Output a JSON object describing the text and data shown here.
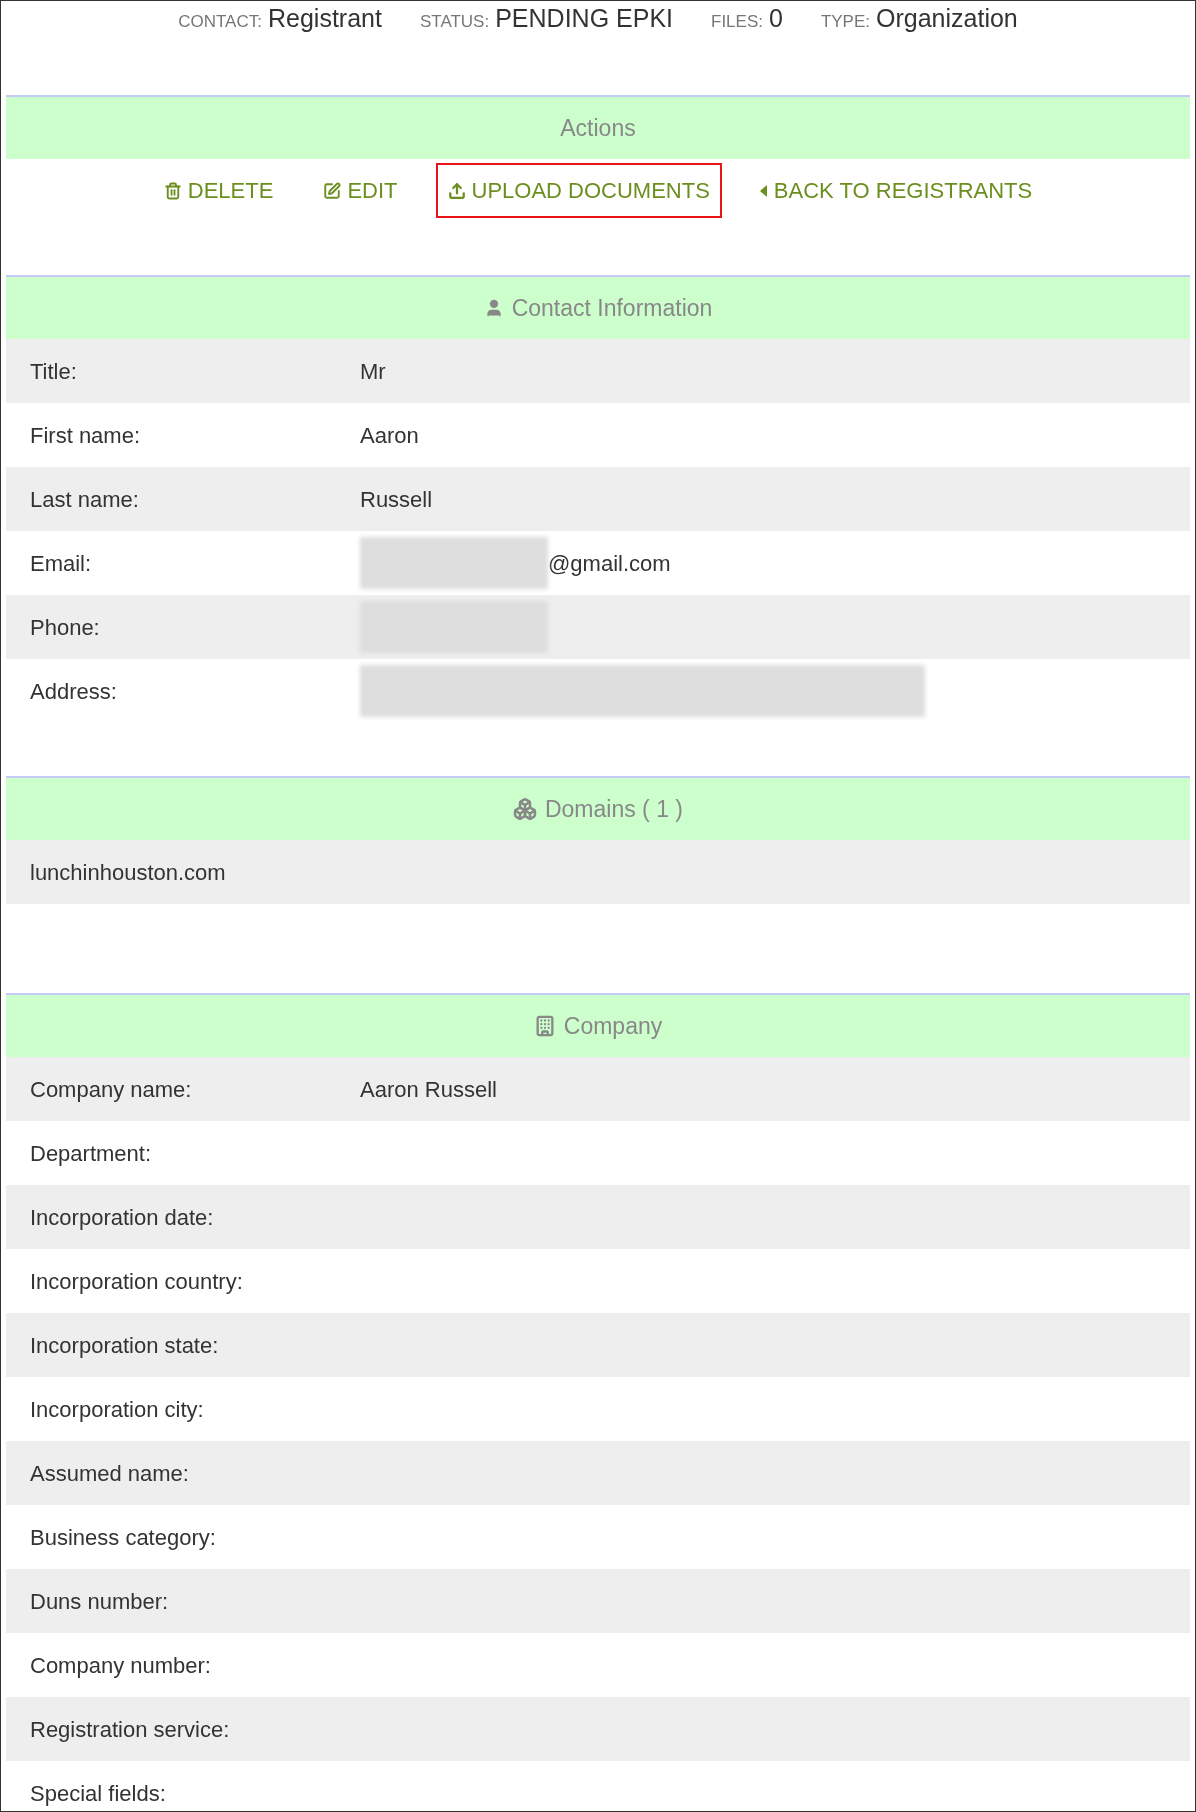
{
  "summary": [
    {
      "label": "CONTACT:",
      "value": "Registrant"
    },
    {
      "label": "STATUS:",
      "value": "PENDING EPKI"
    },
    {
      "label": "FILES:",
      "value": "0"
    },
    {
      "label": "TYPE:",
      "value": "Organization"
    }
  ],
  "actions": {
    "title": "Actions",
    "items": [
      {
        "kind": "delete",
        "label": "DELETE",
        "highlighted": false
      },
      {
        "kind": "edit",
        "label": "EDIT",
        "highlighted": false
      },
      {
        "kind": "upload",
        "label": "UPLOAD DOCUMENTS",
        "highlighted": true
      },
      {
        "kind": "back",
        "label": "BACK TO REGISTRANTS",
        "highlighted": false
      }
    ]
  },
  "contact": {
    "title": "Contact Information",
    "rows": [
      {
        "label": "Title:",
        "value": "Mr"
      },
      {
        "label": "First name:",
        "value": "Aaron"
      },
      {
        "label": "Last name:",
        "value": "Russell"
      },
      {
        "label": "Email:",
        "value": "@gmail.com",
        "redacted": true
      },
      {
        "label": "Phone:",
        "redacted": true
      },
      {
        "label": "Address:",
        "redacted": true
      }
    ]
  },
  "domains": {
    "title": "Domains ( 1 )",
    "items": [
      "lunchinhouston.com"
    ]
  },
  "company": {
    "title": "Company",
    "rows": [
      {
        "label": "Company name:",
        "value": "Aaron Russell"
      },
      {
        "label": "Department:"
      },
      {
        "label": "Incorporation date:"
      },
      {
        "label": "Incorporation country:"
      },
      {
        "label": "Incorporation state:"
      },
      {
        "label": "Incorporation city:"
      },
      {
        "label": "Assumed name:"
      },
      {
        "label": "Business category:"
      },
      {
        "label": "Duns number:"
      },
      {
        "label": "Company number:"
      },
      {
        "label": "Registration service:"
      },
      {
        "label": "Special fields:"
      }
    ]
  }
}
